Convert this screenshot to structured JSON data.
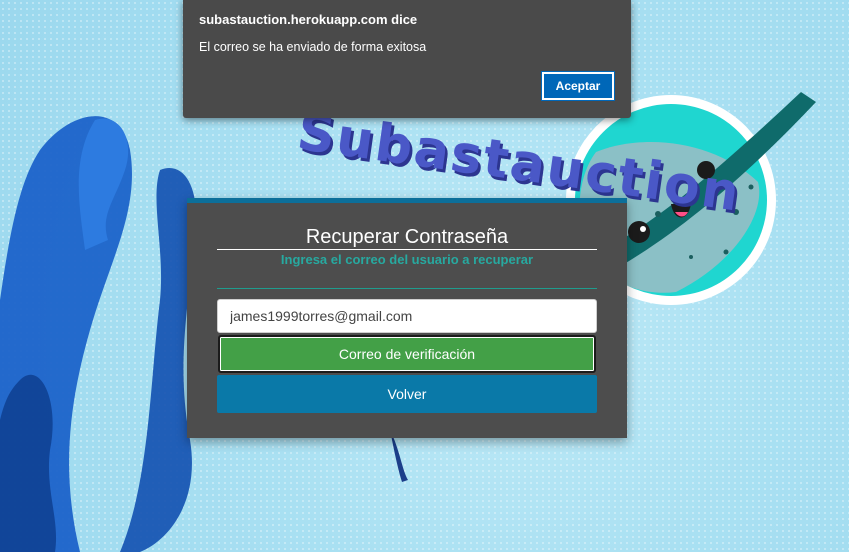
{
  "background": {
    "logo_text": "Subastauction"
  },
  "alert": {
    "title": "subastauction.herokuapp.com dice",
    "message": "El correo se ha enviado de forma exitosa",
    "ok_label": "Aceptar"
  },
  "recover": {
    "title": "Recuperar Contraseña",
    "subtitle": "Ingresa el correo del usuario a recuperar",
    "email_value": "james1999torres@gmail.com",
    "verify_label": "Correo de verificación",
    "back_label": "Volver"
  },
  "colors": {
    "panel_bg": "#4d4d4d",
    "accent_teal": "#27a9a0",
    "verify_green": "#43a047",
    "back_blue": "#0a79a8",
    "alert_button": "#0067b8"
  }
}
